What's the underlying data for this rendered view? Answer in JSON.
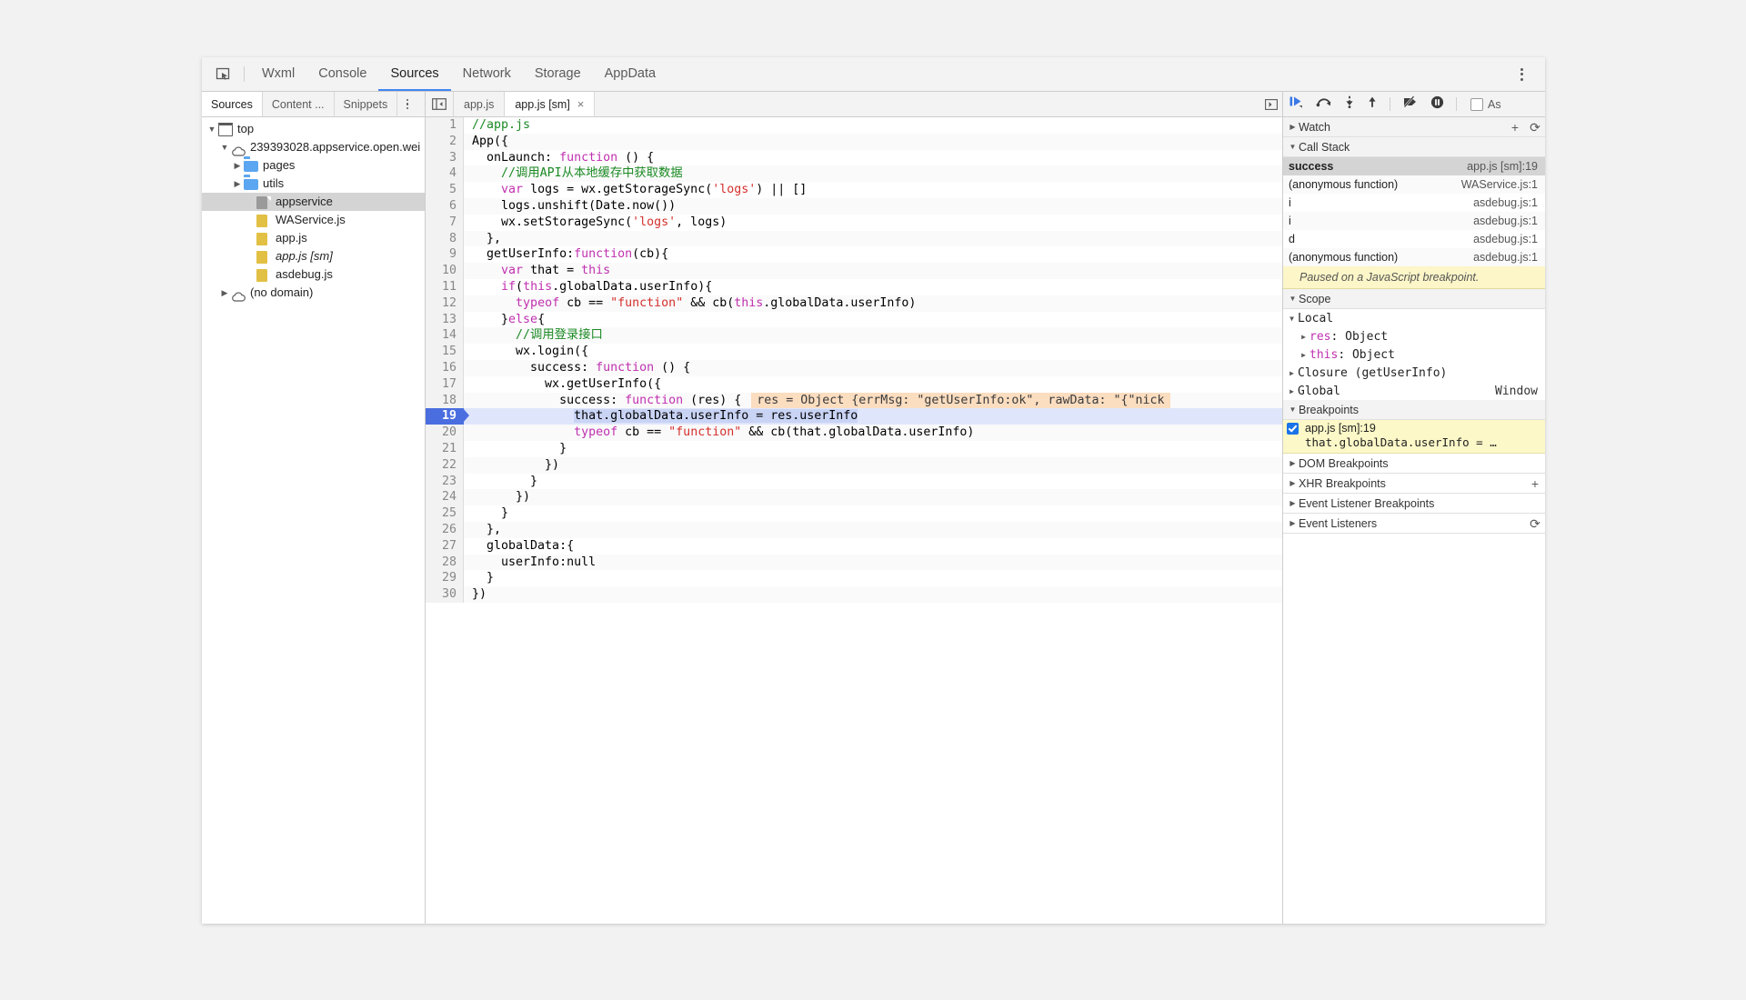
{
  "toolbar": {
    "inspect_icon": "inspect-element-icon",
    "tabs": [
      {
        "label": "Wxml",
        "active": false
      },
      {
        "label": "Console",
        "active": false
      },
      {
        "label": "Sources",
        "active": true
      },
      {
        "label": "Network",
        "active": false
      },
      {
        "label": "Storage",
        "active": false
      },
      {
        "label": "AppData",
        "active": false
      }
    ],
    "menu_icon": "kebab-menu-icon"
  },
  "navigator": {
    "tabs": [
      {
        "label": "Sources",
        "active": true
      },
      {
        "label": "Content ...",
        "active": false
      },
      {
        "label": "Snippets",
        "active": false
      }
    ],
    "menu_icon": "kebab-menu-icon",
    "tree": [
      {
        "label": "top",
        "icon": "window-icon",
        "indent": 0,
        "twisty": "▼",
        "selected": false,
        "italic": false
      },
      {
        "label": "239393028.appservice.open.wei",
        "icon": "cloud-icon",
        "indent": 1,
        "twisty": "▼",
        "selected": false,
        "italic": false
      },
      {
        "label": "pages",
        "icon": "folder-icon",
        "indent": 2,
        "twisty": "▶",
        "selected": false,
        "italic": false
      },
      {
        "label": "utils",
        "icon": "folder-icon",
        "indent": 2,
        "twisty": "▶",
        "selected": false,
        "italic": false
      },
      {
        "label": "appservice",
        "icon": "file-gray-icon",
        "indent": 3,
        "twisty": "",
        "selected": true,
        "italic": false
      },
      {
        "label": "WAService.js",
        "icon": "file-icon",
        "indent": 3,
        "twisty": "",
        "selected": false,
        "italic": false
      },
      {
        "label": "app.js",
        "icon": "file-icon",
        "indent": 3,
        "twisty": "",
        "selected": false,
        "italic": false
      },
      {
        "label": "app.js [sm]",
        "icon": "file-icon",
        "indent": 3,
        "twisty": "",
        "selected": false,
        "italic": true
      },
      {
        "label": "asdebug.js",
        "icon": "file-icon",
        "indent": 3,
        "twisty": "",
        "selected": false,
        "italic": false
      },
      {
        "label": "(no domain)",
        "icon": "cloud-icon",
        "indent": 1,
        "twisty": "▶",
        "selected": false,
        "italic": false
      }
    ]
  },
  "editor": {
    "nav_toggle_icon": "show-navigator-icon",
    "more_icon": "show-more-tabs-icon",
    "tabs": [
      {
        "label": "app.js",
        "active": false,
        "closable": false
      },
      {
        "label": "app.js [sm]",
        "active": true,
        "closable": true,
        "close_label": "×"
      }
    ],
    "execution_line": 19,
    "inline_preview": "res = Object {errMsg: \"getUserInfo:ok\", rawData: \"{\"nick",
    "lines": [
      {
        "n": 1,
        "tokens": [
          {
            "t": "//app.js",
            "c": "com"
          }
        ]
      },
      {
        "n": 2,
        "tokens": [
          {
            "t": "App({",
            "c": ""
          }
        ]
      },
      {
        "n": 3,
        "tokens": [
          {
            "t": "  onLaunch: ",
            "c": ""
          },
          {
            "t": "function",
            "c": "kw"
          },
          {
            "t": " () {",
            "c": ""
          }
        ]
      },
      {
        "n": 4,
        "tokens": [
          {
            "t": "    //调用API从本地缓存中获取数据",
            "c": "com"
          }
        ]
      },
      {
        "n": 5,
        "tokens": [
          {
            "t": "    ",
            "c": ""
          },
          {
            "t": "var",
            "c": "kw"
          },
          {
            "t": " logs = wx.getStorageSync(",
            "c": ""
          },
          {
            "t": "'logs'",
            "c": "str"
          },
          {
            "t": ") || []",
            "c": ""
          }
        ]
      },
      {
        "n": 6,
        "tokens": [
          {
            "t": "    logs.unshift(Date.now())",
            "c": ""
          }
        ]
      },
      {
        "n": 7,
        "tokens": [
          {
            "t": "    wx.setStorageSync(",
            "c": ""
          },
          {
            "t": "'logs'",
            "c": "str"
          },
          {
            "t": ", logs)",
            "c": ""
          }
        ]
      },
      {
        "n": 8,
        "tokens": [
          {
            "t": "  },",
            "c": ""
          }
        ]
      },
      {
        "n": 9,
        "tokens": [
          {
            "t": "  getUserInfo:",
            "c": ""
          },
          {
            "t": "function",
            "c": "kw"
          },
          {
            "t": "(cb){",
            "c": ""
          }
        ]
      },
      {
        "n": 10,
        "tokens": [
          {
            "t": "    ",
            "c": ""
          },
          {
            "t": "var",
            "c": "kw"
          },
          {
            "t": " that = ",
            "c": ""
          },
          {
            "t": "this",
            "c": "kw"
          }
        ]
      },
      {
        "n": 11,
        "tokens": [
          {
            "t": "    ",
            "c": ""
          },
          {
            "t": "if",
            "c": "kw"
          },
          {
            "t": "(",
            "c": ""
          },
          {
            "t": "this",
            "c": "kw"
          },
          {
            "t": ".globalData.userInfo){",
            "c": ""
          }
        ]
      },
      {
        "n": 12,
        "tokens": [
          {
            "t": "      ",
            "c": ""
          },
          {
            "t": "typeof",
            "c": "kw"
          },
          {
            "t": " cb == ",
            "c": ""
          },
          {
            "t": "\"function\"",
            "c": "str"
          },
          {
            "t": " && cb(",
            "c": ""
          },
          {
            "t": "this",
            "c": "kw"
          },
          {
            "t": ".globalData.userInfo)",
            "c": ""
          }
        ]
      },
      {
        "n": 13,
        "tokens": [
          {
            "t": "    }",
            "c": ""
          },
          {
            "t": "else",
            "c": "kw"
          },
          {
            "t": "{",
            "c": ""
          }
        ]
      },
      {
        "n": 14,
        "tokens": [
          {
            "t": "      //调用登录接口",
            "c": "com"
          }
        ]
      },
      {
        "n": 15,
        "tokens": [
          {
            "t": "      wx.login({",
            "c": ""
          }
        ]
      },
      {
        "n": 16,
        "tokens": [
          {
            "t": "        success: ",
            "c": ""
          },
          {
            "t": "function",
            "c": "kw"
          },
          {
            "t": " () {",
            "c": ""
          }
        ]
      },
      {
        "n": 17,
        "tokens": [
          {
            "t": "          wx.getUserInfo({",
            "c": ""
          }
        ]
      },
      {
        "n": 18,
        "tokens": [
          {
            "t": "            success: ",
            "c": ""
          },
          {
            "t": "function",
            "c": "kw"
          },
          {
            "t": " (res) {",
            "c": ""
          }
        ]
      },
      {
        "n": 19,
        "tokens": [
          {
            "t": "              ",
            "c": ""
          },
          {
            "t": "that.globalData.userInfo = res.userInfo",
            "c": "sel"
          }
        ]
      },
      {
        "n": 20,
        "tokens": [
          {
            "t": "              ",
            "c": ""
          },
          {
            "t": "typeof",
            "c": "kw"
          },
          {
            "t": " cb == ",
            "c": ""
          },
          {
            "t": "\"function\"",
            "c": "str"
          },
          {
            "t": " && cb(that.globalData.userInfo)",
            "c": ""
          }
        ]
      },
      {
        "n": 21,
        "tokens": [
          {
            "t": "            }",
            "c": ""
          }
        ]
      },
      {
        "n": 22,
        "tokens": [
          {
            "t": "          })",
            "c": ""
          }
        ]
      },
      {
        "n": 23,
        "tokens": [
          {
            "t": "        }",
            "c": ""
          }
        ]
      },
      {
        "n": 24,
        "tokens": [
          {
            "t": "      })",
            "c": ""
          }
        ]
      },
      {
        "n": 25,
        "tokens": [
          {
            "t": "    }",
            "c": ""
          }
        ]
      },
      {
        "n": 26,
        "tokens": [
          {
            "t": "  },",
            "c": ""
          }
        ]
      },
      {
        "n": 27,
        "tokens": [
          {
            "t": "  globalData:{",
            "c": ""
          }
        ]
      },
      {
        "n": 28,
        "tokens": [
          {
            "t": "    userInfo:null",
            "c": ""
          }
        ]
      },
      {
        "n": 29,
        "tokens": [
          {
            "t": "  }",
            "c": ""
          }
        ]
      },
      {
        "n": 30,
        "tokens": [
          {
            "t": "})",
            "c": ""
          }
        ]
      }
    ]
  },
  "debugger": {
    "controls": [
      {
        "name": "resume-script-execution-button",
        "icon": "resume-icon"
      },
      {
        "name": "step-over-button",
        "icon": "step-over-icon"
      },
      {
        "name": "step-into-button",
        "icon": "step-into-icon"
      },
      {
        "name": "step-out-button",
        "icon": "step-out-icon"
      },
      {
        "name": "deactivate-breakpoints-button",
        "icon": "deactivate-breakpoints-icon"
      },
      {
        "name": "pause-on-exceptions-button",
        "icon": "pause-on-exceptions-icon"
      }
    ],
    "async_label": "As",
    "watch": {
      "title": "Watch",
      "caret": "▶",
      "add_label": "+",
      "refresh_label": "⟳"
    },
    "call_stack": {
      "title": "Call Stack",
      "caret": "▼",
      "frames": [
        {
          "name": "success",
          "location": "app.js [sm]:19",
          "selected": true
        },
        {
          "name": "(anonymous function)",
          "location": "WAService.js:1",
          "selected": false
        },
        {
          "name": "i",
          "location": "asdebug.js:1",
          "selected": false
        },
        {
          "name": "i",
          "location": "asdebug.js:1",
          "selected": false
        },
        {
          "name": "d",
          "location": "asdebug.js:1",
          "selected": false
        },
        {
          "name": "(anonymous function)",
          "location": "asdebug.js:1",
          "selected": false
        }
      ]
    },
    "paused_message": "Paused on a JavaScript breakpoint.",
    "scope": {
      "title": "Scope",
      "caret": "▼",
      "rows": [
        {
          "caret": "▼",
          "name": "Local",
          "value": "",
          "indent": 0,
          "prop": false
        },
        {
          "caret": "▶",
          "name": "res",
          "value": "",
          "suffix": ": Object",
          "indent": 1,
          "prop": true
        },
        {
          "caret": "▶",
          "name": "this",
          "value": "",
          "suffix": ": Object",
          "indent": 1,
          "prop": true
        },
        {
          "caret": "▶",
          "name": "Closure (getUserInfo)",
          "value": "",
          "indent": 0,
          "prop": false
        },
        {
          "caret": "▶",
          "name": "Global",
          "value": "Window",
          "indent": 0,
          "prop": false
        }
      ]
    },
    "breakpoints": {
      "title": "Breakpoints",
      "caret": "▼",
      "items": [
        {
          "checked": true,
          "location": "app.js [sm]:19",
          "code": "that.globalData.userInfo = …"
        }
      ]
    },
    "collapsed_sections": [
      {
        "title": "DOM Breakpoints",
        "caret": "▶",
        "action": ""
      },
      {
        "title": "XHR Breakpoints",
        "caret": "▶",
        "action": "+"
      },
      {
        "title": "Event Listener Breakpoints",
        "caret": "▶",
        "action": ""
      },
      {
        "title": "Event Listeners",
        "caret": "▶",
        "action": "⟳"
      }
    ]
  },
  "colors": {
    "accent": "#4285f4",
    "execution_line": "#dfe6fb",
    "breakpoint": "#1a73e8",
    "paused_banner": "#fcf6c8",
    "preview": "#fbddc0"
  }
}
